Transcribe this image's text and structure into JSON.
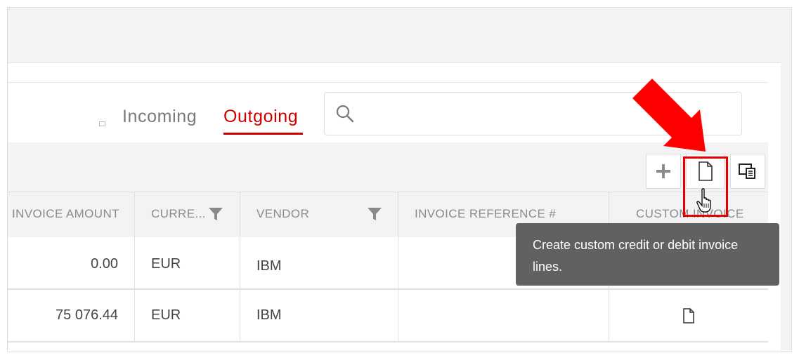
{
  "tabs": [
    {
      "label": "Incoming",
      "active": false
    },
    {
      "label": "Outgoing",
      "active": true
    }
  ],
  "search": {
    "placeholder": "",
    "value": ""
  },
  "toolbar": {
    "add_icon": "plus-icon",
    "custom_invoice_icon": "document-icon",
    "columns_icon": "column-chooser-icon"
  },
  "columns": [
    {
      "label": "INVOICE AMOUNT",
      "filter": false
    },
    {
      "label": "CURRE...",
      "filter": true
    },
    {
      "label": "VENDOR",
      "filter": true
    },
    {
      "label": "INVOICE REFERENCE #",
      "filter": false
    },
    {
      "label": "CUSTOM INVOICE",
      "filter": false
    }
  ],
  "rows": [
    {
      "amount": "0.00",
      "currency": "EUR",
      "vendor": "IBM",
      "reference": "",
      "custom_icon": false
    },
    {
      "amount": "75 076.44",
      "currency": "EUR",
      "vendor": "IBM",
      "reference": "",
      "custom_icon": true
    }
  ],
  "tooltip": {
    "text": "Create custom credit or debit invoice lines."
  },
  "colors": {
    "accent": "#cc0000",
    "tooltip_bg": "#616161",
    "header_bg": "#f3f3f3"
  }
}
